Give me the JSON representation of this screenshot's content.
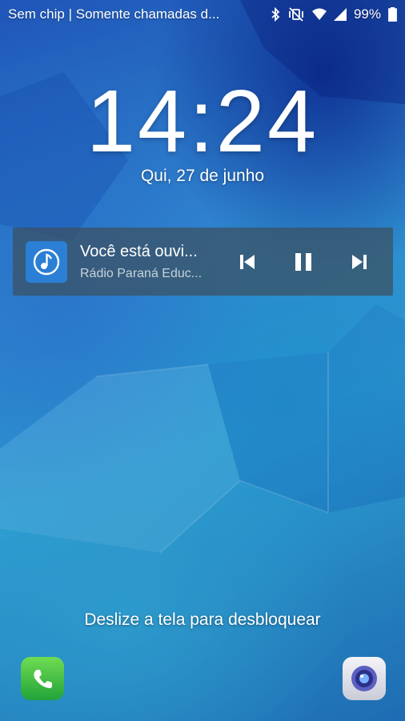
{
  "status_bar": {
    "carrier_text": "Sem chip | Somente chamadas d...",
    "battery_percent": "99%",
    "battery_level": 0.99,
    "icons": [
      "bluetooth-icon",
      "vibrate-mute-icon",
      "wifi-icon",
      "signal-icon",
      "battery-icon"
    ]
  },
  "clock": {
    "hours": "14",
    "separator": ":",
    "minutes": "24"
  },
  "date": "Qui, 27 de junho",
  "media": {
    "app_icon": "music-note-icon",
    "title": "Você está ouvi...",
    "subtitle": "Rádio Paraná Educ...",
    "controls": [
      "previous-icon",
      "pause-icon",
      "next-icon"
    ]
  },
  "unlock_hint": "Deslize a tela para desbloquear",
  "shortcuts": {
    "left": "phone-icon",
    "right": "camera-icon"
  },
  "colors": {
    "media_panel": "#3c505f",
    "app_icon_bg": "#2b7fd4",
    "phone_green": "#3cbf43"
  }
}
